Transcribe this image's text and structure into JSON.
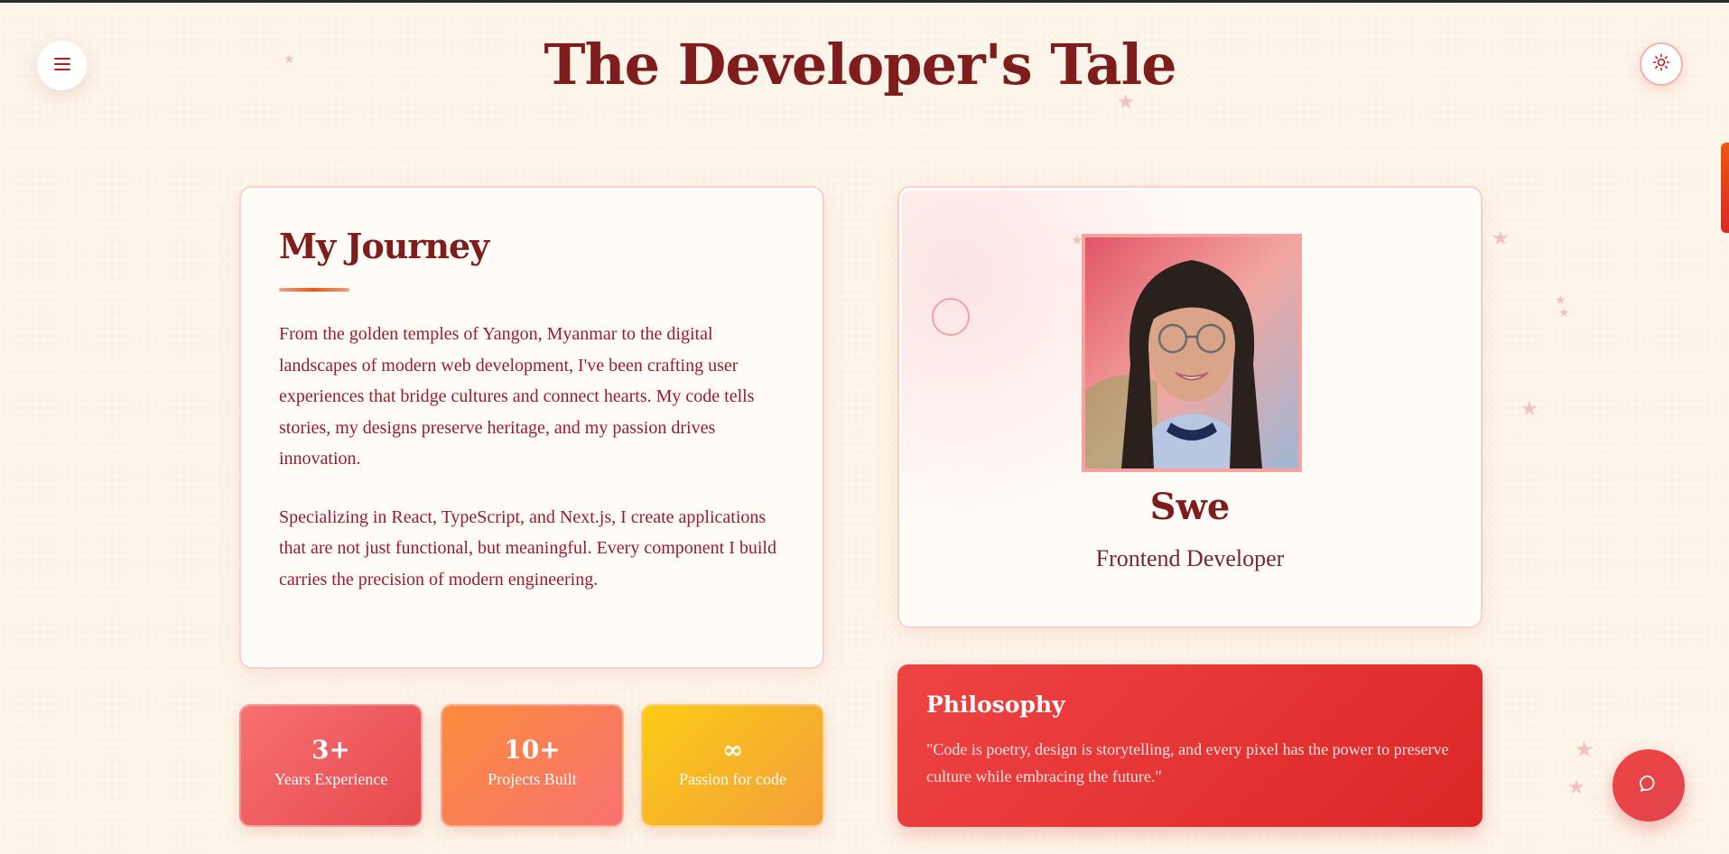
{
  "header": {
    "title": "The Developer's Tale",
    "menu_icon": "hamburger-menu-icon",
    "theme_icon": "sun-icon"
  },
  "journey": {
    "heading": "My Journey",
    "paragraphs": [
      "From the golden temples of Yangon, Myanmar to the digital landscapes of modern web development, I've been crafting user experiences that bridge cultures and connect hearts. My code tells stories, my designs preserve heritage, and my passion drives innovation.",
      "Specializing in React, TypeScript, and Next.js, I create applications that are not just functional, but meaningful. Every component I build carries the precision of modern engineering."
    ]
  },
  "profile": {
    "name": "Swe",
    "role": "Frontend Developer"
  },
  "stats": [
    {
      "value": "3+",
      "label": "Years Experience"
    },
    {
      "value": "10+",
      "label": "Projects Built"
    },
    {
      "value": "∞",
      "label": "Passion for code"
    }
  ],
  "philosophy": {
    "heading": "Philosophy",
    "quote": "\"Code is poetry, design is storytelling, and every pixel has the power to preserve culture while embracing the future.\""
  },
  "chat": {
    "icon": "chat-bubble-icon"
  },
  "colors": {
    "background": "#fdf5ea",
    "title": "#7f1d1d",
    "accent_red": "#dc2626",
    "accent_orange": "#ea580c",
    "accent_yellow": "#facc15"
  }
}
